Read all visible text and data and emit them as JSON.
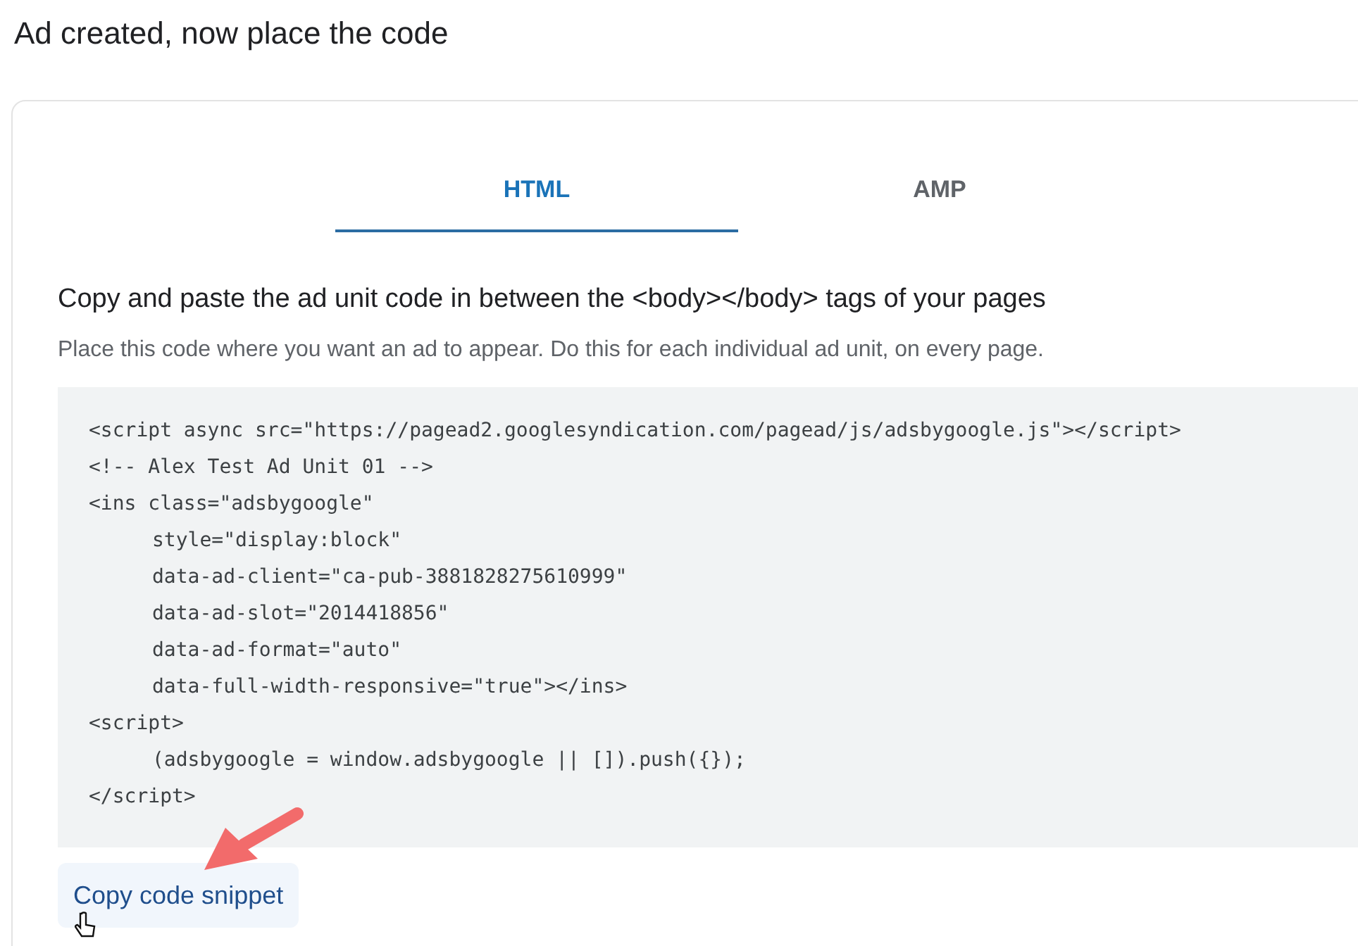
{
  "page_title": "Ad created, now place the code",
  "tabs": [
    {
      "label": "HTML",
      "selected": true
    },
    {
      "label": "AMP",
      "selected": false
    }
  ],
  "heading": "Copy and paste the ad unit code in between the <body></body> tags of your pages",
  "description": "Place this code where you want an ad to appear. Do this for each individual ad unit, on every page.",
  "code_lines": [
    {
      "text": "<script async src=\"https://pagead2.googlesyndication.com/pagead/js/adsbygoogle.js\"></script>"
    },
    {
      "text": "<!-- Alex Test Ad Unit 01 -->"
    },
    {
      "text": "<ins class=\"adsbygoogle\"",
      "children": [
        {
          "text": "style=\"display:block\""
        },
        {
          "text": "data-ad-client=\"ca-pub-3881828275610999\""
        },
        {
          "text": "data-ad-slot=\"2014418856\""
        },
        {
          "text": "data-ad-format=\"auto\""
        },
        {
          "text": "data-full-width-responsive=\"true\"></ins>"
        }
      ]
    },
    {
      "text": "<script>",
      "children": [
        {
          "text": "(adsbygoogle = window.adsbygoogle || []).push({});"
        }
      ]
    },
    {
      "text": "</script>"
    }
  ],
  "copy_button": "Copy code snippet"
}
